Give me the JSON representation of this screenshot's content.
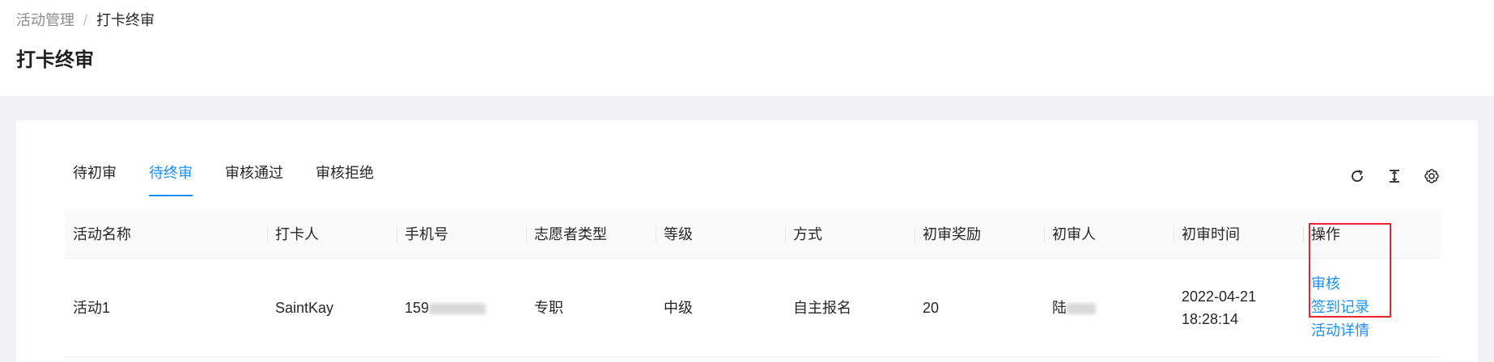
{
  "breadcrumb": {
    "parent": "活动管理",
    "separator": "/",
    "current": "打卡终审"
  },
  "page_title": "打卡终审",
  "tabs": [
    {
      "label": "待初审",
      "active": false
    },
    {
      "label": "待终审",
      "active": true
    },
    {
      "label": "审核通过",
      "active": false
    },
    {
      "label": "审核拒绝",
      "active": false
    }
  ],
  "toolbar": {
    "icons": [
      "reload-icon",
      "column-height-icon",
      "setting-icon"
    ]
  },
  "table": {
    "headers": [
      "活动名称",
      "打卡人",
      "手机号",
      "志愿者类型",
      "等级",
      "方式",
      "初审奖励",
      "初审人",
      "初审时间",
      "操作"
    ],
    "rows": [
      {
        "activity": "活动1",
        "person": "SaintKay",
        "phone_prefix": "159",
        "volunteer_type": "专职",
        "level": "中级",
        "method": "自主报名",
        "reward": "20",
        "reviewer_prefix": "陆",
        "review_date": "2022-04-21",
        "review_time": "18:28:14",
        "actions": [
          "审核",
          "签到记录",
          "活动详情"
        ]
      }
    ]
  },
  "colors": {
    "accent": "#1890ff",
    "highlight_box": "#e8262b"
  }
}
